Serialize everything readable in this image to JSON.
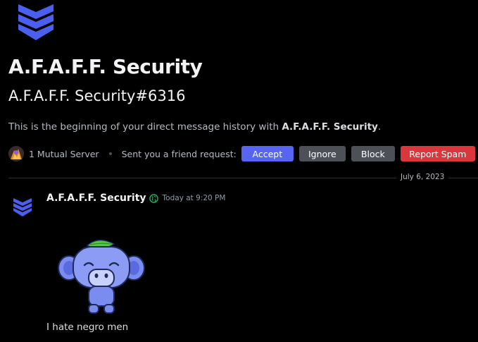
{
  "profile": {
    "display_name": "A.F.A.F.F. Security",
    "username_tag": "A.F.A.F.F. Security#6316",
    "intro_prefix": "This is the beginning of your direct message history with ",
    "intro_name": "A.F.A.F.F. Security",
    "intro_suffix": "."
  },
  "mutual": {
    "label": "1 Mutual Server",
    "request_text": "Sent you a friend request:"
  },
  "actions": {
    "accept": "Accept",
    "ignore": "Ignore",
    "block": "Block",
    "report": "Report Spam"
  },
  "divider": {
    "date": "July 6, 2023"
  },
  "message": {
    "author": "A.F.A.F.F. Security",
    "timestamp": "Today at 9:20 PM",
    "text": "I hate negro men"
  },
  "icons": {
    "logo": "chevron-stack-shield-icon",
    "status": "globe-icon",
    "sticker": "wumpus-sticker"
  },
  "colors": {
    "accent": "#5865f2",
    "danger": "#da373c",
    "neutral_button": "#4e5058",
    "logo_blue": "#4a5ff0",
    "status_green": "#23a55a"
  }
}
